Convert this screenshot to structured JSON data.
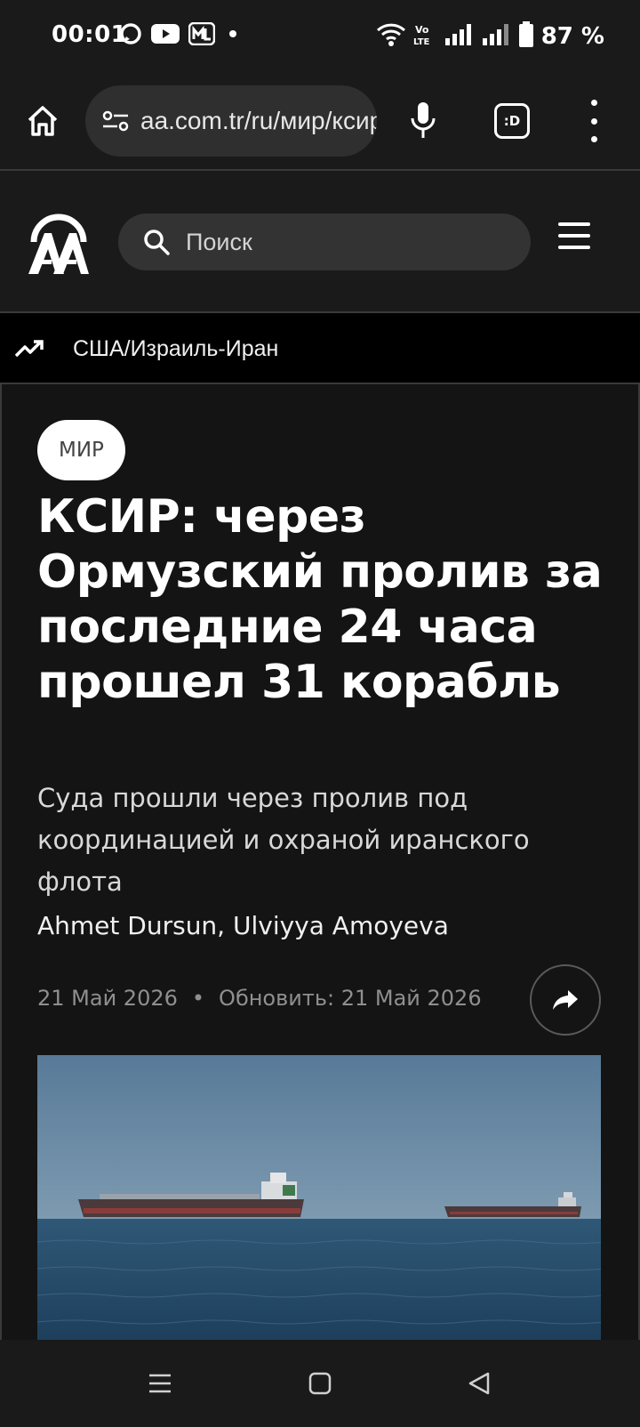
{
  "status_bar": {
    "time": "00:01",
    "battery_percent": "87 %",
    "icons": [
      "chat-bubble-icon",
      "youtube-icon",
      "magnit-app-icon",
      "notification-dot-icon",
      "wifi-icon",
      "volte-icon",
      "signal-icon",
      "signal-icon",
      "battery-icon"
    ]
  },
  "browser": {
    "url": "aa.com.tr/ru/мир/ксир-через",
    "tab_label": ":D",
    "icons": [
      "home-icon",
      "site-settings-icon",
      "microphone-icon",
      "tab-switcher-icon",
      "overflow-menu-icon"
    ]
  },
  "site_header": {
    "search_placeholder": "Поиск",
    "icons": [
      "aa-logo",
      "search-icon",
      "hamburger-menu-icon"
    ]
  },
  "trending": {
    "label": "США/Израиль-Иран",
    "icon": "trending-up-icon"
  },
  "article": {
    "category": "МИР",
    "headline": "КСИР: через Ормузский пролив за последние 24 часа прошел 31 корабль",
    "subheadline": "Суда прошли через пролив под координацией и охраной иранского флота",
    "authors": "Ahmet Dursun, Ulviyya Amoyeva",
    "published": "21 Май 2026",
    "separator": "•",
    "updated": "Обновить: 21 Май 2026",
    "share_icon": "share-arrow-icon",
    "image_description": "hero-photo"
  },
  "nav_bar": {
    "icons": [
      "recent-apps-icon",
      "home-square-icon",
      "back-triangle-icon"
    ]
  },
  "colors": {
    "background": "#141414",
    "chrome": "#1a1a1a",
    "pill": "#2f2f2f",
    "muted_text": "#8f8f8f"
  }
}
